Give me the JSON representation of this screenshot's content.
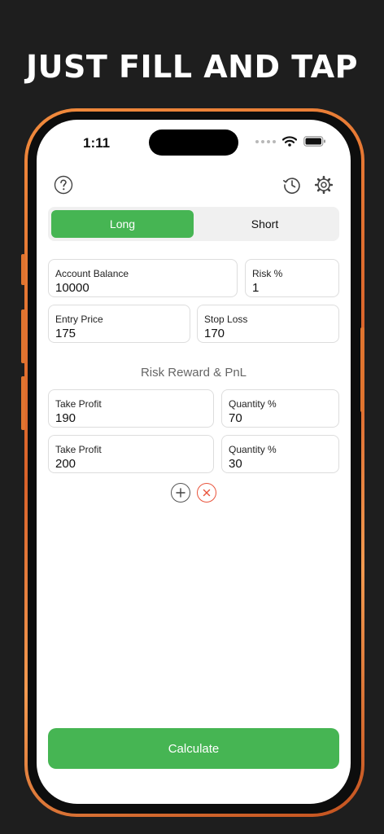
{
  "headline": "JUST FILL AND TAP",
  "status_bar": {
    "time": "1:11"
  },
  "icons": {
    "help": "question-circle-icon",
    "history": "history-clock-icon",
    "settings": "gear-icon"
  },
  "segment": {
    "long_label": "Long",
    "short_label": "Short",
    "selected": "Long"
  },
  "fields": {
    "account_balance": {
      "label": "Account Balance",
      "value": "10000"
    },
    "risk": {
      "label": "Risk %",
      "value": "1"
    },
    "entry_price": {
      "label": "Entry Price",
      "value": "175"
    },
    "stop_loss": {
      "label": "Stop Loss",
      "value": "170"
    }
  },
  "section_title": "Risk Reward & PnL",
  "targets": [
    {
      "tp_label": "Take Profit",
      "tp_value": "190",
      "qty_label": "Quantity %",
      "qty_value": "70"
    },
    {
      "tp_label": "Take Profit",
      "tp_value": "200",
      "qty_label": "Quantity %",
      "qty_value": "30"
    }
  ],
  "calculate_label": "Calculate",
  "colors": {
    "accent_green": "#46b553",
    "remove_red": "#e9543c",
    "frame_orange": "#e0742f"
  }
}
